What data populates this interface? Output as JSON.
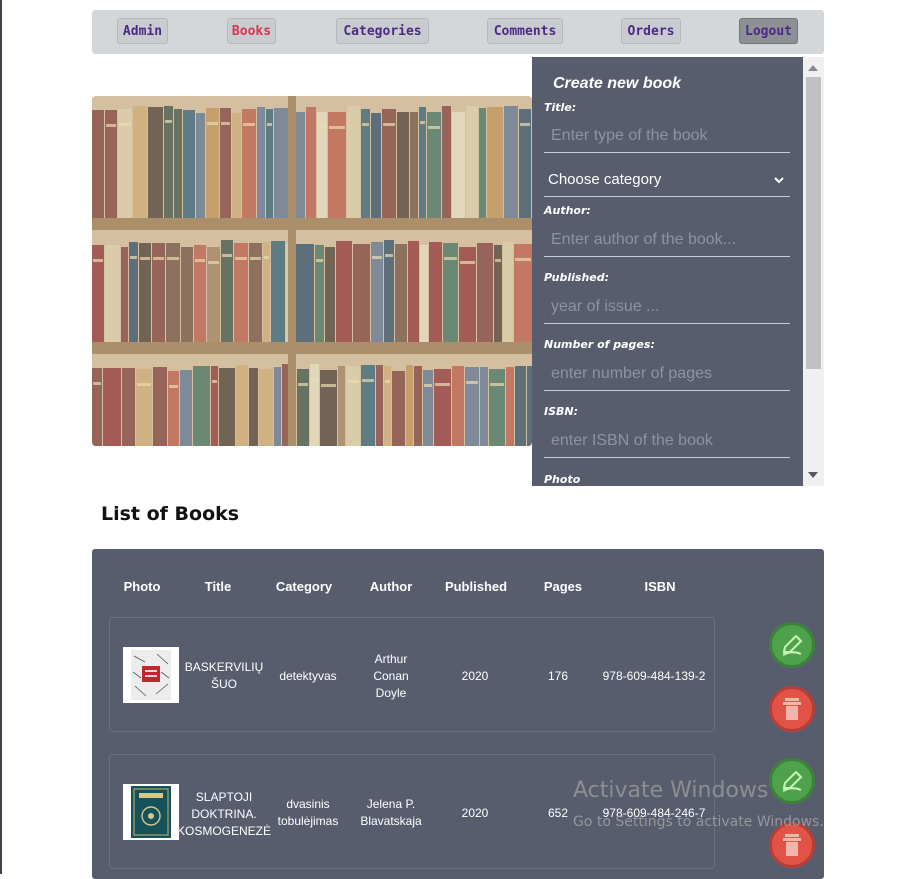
{
  "nav": {
    "items": [
      {
        "label": "Admin"
      },
      {
        "label": "Books",
        "active": true
      },
      {
        "label": "Categories"
      },
      {
        "label": "Comments"
      },
      {
        "label": "Orders"
      },
      {
        "label": "Logout"
      }
    ]
  },
  "form": {
    "title": "Create new book",
    "fields": {
      "title": {
        "label": "Title:",
        "placeholder": "Enter type of the book",
        "value": ""
      },
      "category": {
        "selected": "Choose category"
      },
      "author": {
        "label": "Author:",
        "placeholder": "Enter author of the book...",
        "value": ""
      },
      "published": {
        "label": "Published:",
        "placeholder": "year of issue ...",
        "value": ""
      },
      "pages": {
        "label": "Number of pages:",
        "placeholder": "enter number of pages",
        "value": ""
      },
      "isbn": {
        "label": "ISBN:",
        "placeholder": "enter ISBN of the book",
        "value": ""
      },
      "photo": {
        "label": "Photo"
      }
    }
  },
  "list": {
    "heading": "List of Books",
    "columns": [
      "Photo",
      "Title",
      "Category",
      "Author",
      "Published",
      "Pages",
      "ISBN"
    ],
    "rows": [
      {
        "title": "BASKERVILIŲ ŠUO",
        "category": "detektyvas",
        "author": "Arthur Conan Doyle",
        "published": "2020",
        "pages": "176",
        "isbn": "978-609-484-139-2",
        "photo_icon": "book-cover-baskerviliu"
      },
      {
        "title": "SLAPTOJI DOKTRINA. KOSMOGENEZĖ",
        "category": "dvasinis tobulėjimas",
        "author": "Jelena P. Blavatskaja",
        "published": "2020",
        "pages": "652",
        "isbn": "978-609-484-246-7",
        "photo_icon": "book-cover-slaptoji-doktrina"
      }
    ]
  },
  "watermark": {
    "title": "Activate Windows",
    "subtitle": "Go to Settings to activate Windows."
  },
  "colors": {
    "panel": "#585d6e",
    "nav_bg": "#d4d7da",
    "active_nav": "#e0314a",
    "nav_text": "#4b2a82",
    "edit": "#4ea24b",
    "delete": "#e15247"
  }
}
